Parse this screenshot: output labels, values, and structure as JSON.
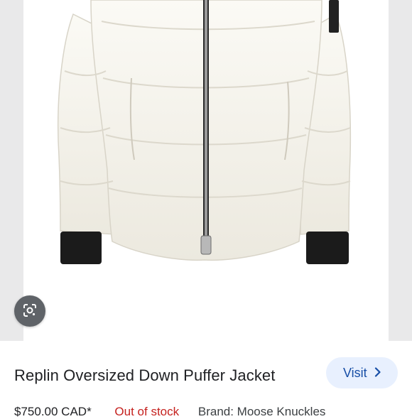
{
  "product": {
    "title": "Replin Oversized Down Puffer Jacket",
    "price": "$750.00 CAD*",
    "stock_status": "Out of stock",
    "brand": "Brand: Moose Knuckles"
  },
  "actions": {
    "visit_label": "Visit"
  },
  "icons": {
    "lens": "lens-camera-icon",
    "visit": "chevron-right-icon"
  },
  "colors": {
    "visit_button_bg": "#e8f0fe",
    "visit_text": "#174ea6",
    "stock_out": "#c5221f",
    "lens_button_bg": "#5f6368"
  }
}
